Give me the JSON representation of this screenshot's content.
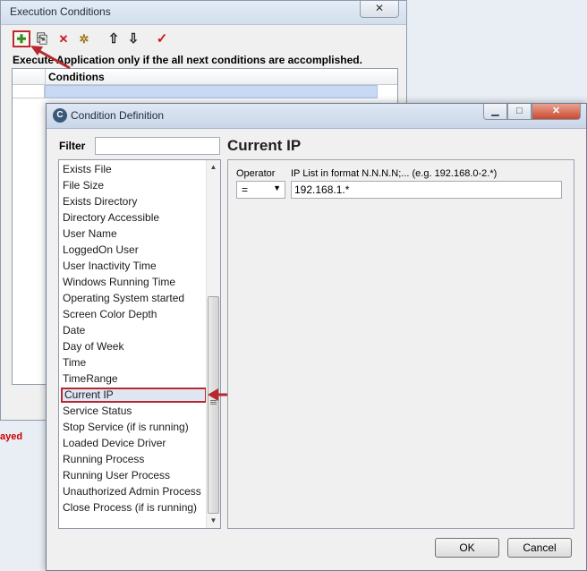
{
  "exec_window": {
    "title": "Execution Conditions",
    "close_glyph": "✕",
    "info_text": "Execute Application only if the all next conditions are accomplished.",
    "grid_header": "Conditions",
    "toolbar": {
      "add_glyph": "✚",
      "copy_glyph": "⎘",
      "delete_glyph": "✕",
      "config_glyph": "✲",
      "up_glyph": "⇧",
      "down_glyph": "⇩",
      "check_glyph": "✓"
    }
  },
  "background_text": "ayed",
  "cond_window": {
    "title": "Condition Definition",
    "app_icon_glyph": "C",
    "min_glyph": "▁",
    "max_glyph": "□",
    "close_glyph": "✕",
    "filter_label": "Filter",
    "filter_value": "",
    "items": [
      "Exists File",
      "File Size",
      "Exists Directory",
      "Directory Accessible",
      "User Name",
      "LoggedOn User",
      "User Inactivity Time",
      "Windows Running Time",
      "Operating System started",
      "Screen Color Depth",
      "Date",
      "Day of Week",
      "Time",
      "TimeRange",
      "Current IP",
      "Service Status",
      "Stop Service (if is running)",
      "Loaded Device Driver",
      "Running Process",
      "Running User Process",
      "Unauthorized Admin Process",
      "Close Process (if is running)"
    ],
    "selected_item": "Current IP",
    "heading": "Current IP",
    "operator_label": "Operator",
    "operator_value": "=",
    "ip_label": "IP List in format N.N.N.N;... (e.g. 192.168.0-2.*)",
    "ip_value": "192.168.1.*",
    "ok_label": "OK",
    "cancel_label": "Cancel"
  },
  "colors": {
    "annotation_red": "#b8282d",
    "selection_blue": "#c8d9f3"
  }
}
